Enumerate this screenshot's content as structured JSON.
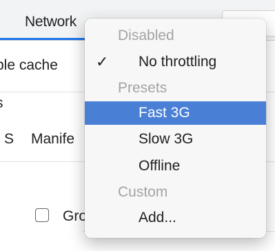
{
  "background": {
    "tab_label": "Network",
    "cache_text": "ble cache",
    "s_text": "s",
    "filter_s": "S",
    "manifest_text": "Manife",
    "group_text": "Gro"
  },
  "menu": {
    "disabled_header": "Disabled",
    "no_throttling": "No throttling",
    "presets_header": "Presets",
    "fast_3g": "Fast 3G",
    "slow_3g": "Slow 3G",
    "offline": "Offline",
    "custom_header": "Custom",
    "add": "Add...",
    "check_glyph": "✓"
  },
  "colors": {
    "selection": "#4a7fd6",
    "header_text": "#a3a3a3",
    "accent": "#1a73e8"
  }
}
